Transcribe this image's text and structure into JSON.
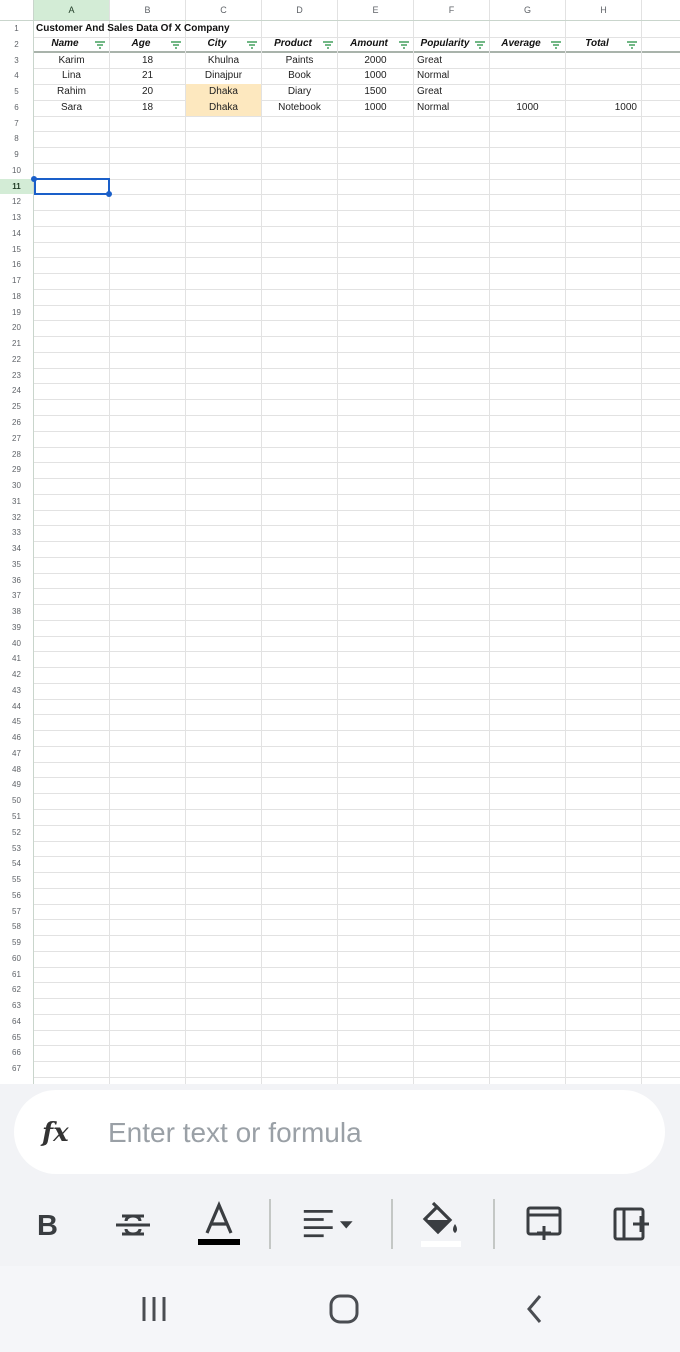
{
  "sheet": {
    "columns": [
      "A",
      "B",
      "C",
      "D",
      "E",
      "F",
      "G",
      "H"
    ],
    "selected_column": "A",
    "selected_row": 11,
    "row_count": 67,
    "title": "Customer And Sales Data Of X Company",
    "headers": [
      "Name",
      "Age",
      "City",
      "Product",
      "Amount",
      "Popularity",
      "Average",
      "Total"
    ],
    "rows": [
      [
        "Karim",
        "18",
        "Khulna",
        "Paints",
        "2000",
        "Great",
        "",
        ""
      ],
      [
        "Lina",
        "21",
        "Dinajpur",
        "Book",
        "1000",
        "Normal",
        "",
        ""
      ],
      [
        "Rahim",
        "20",
        "Dhaka",
        "Diary",
        "1500",
        "Great",
        "",
        ""
      ],
      [
        "Sara",
        "18",
        "Dhaka",
        "Notebook",
        "1000",
        "Normal",
        "1000",
        "1000"
      ]
    ],
    "highlight_color": "#fde8bf",
    "selection_color": "#1a5fc9",
    "header_highlight_color": "#d3ecd6"
  },
  "formula_bar": {
    "icon": "fx-icon",
    "placeholder": "Enter text or formula"
  },
  "toolbar": {
    "items": [
      "bold-icon",
      "strikethrough-icon",
      "text-color-icon",
      "align-icon",
      "fill-color-icon",
      "insert-row-icon",
      "insert-column-icon"
    ]
  },
  "navbar": {
    "items": [
      "recent-apps-icon",
      "home-icon",
      "back-icon"
    ]
  }
}
